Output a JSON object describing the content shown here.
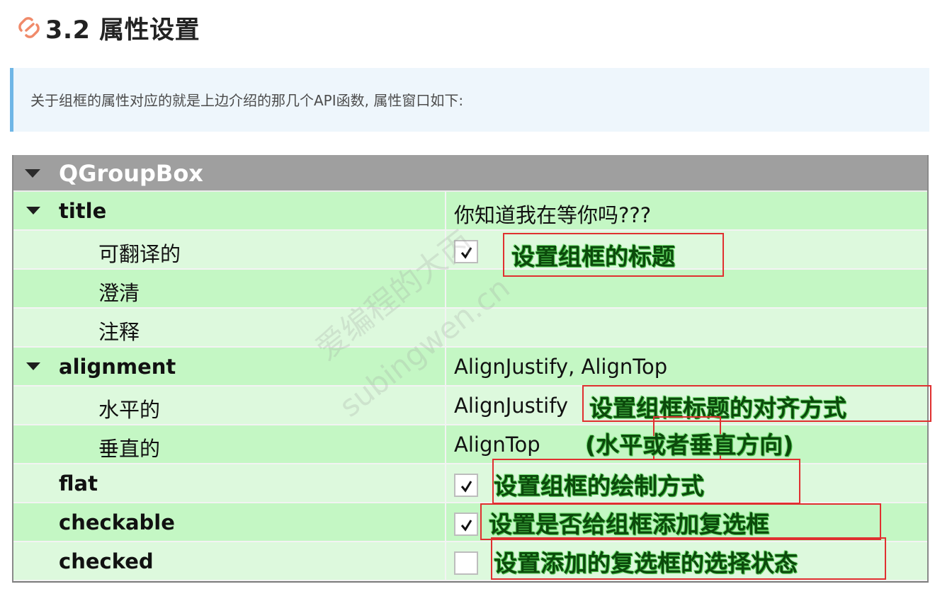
{
  "section": {
    "number_title": "3.2 属性设置",
    "icon": "link-icon",
    "note": "关于组框的属性对应的就是上边介绍的那几个API函数, 属性窗口如下:"
  },
  "property_editor": {
    "class_name": "QGroupBox",
    "rows": [
      {
        "name": "title",
        "value": "你知道我在等你吗???"
      },
      {
        "name": "可翻译的",
        "checked": true
      },
      {
        "name": "澄清",
        "value": ""
      },
      {
        "name": "注释",
        "value": ""
      },
      {
        "name": "alignment",
        "value": "AlignJustify, AlignTop"
      },
      {
        "name": "水平的",
        "value": "AlignJustify"
      },
      {
        "name": "垂直的",
        "value": "AlignTop"
      },
      {
        "name": "flat",
        "checked": true
      },
      {
        "name": "checkable",
        "checked": true
      },
      {
        "name": "checked",
        "checked": false
      }
    ]
  },
  "annotations": {
    "title_label": "设置组框的标题",
    "alignment_label": "设置组框标题的对齐方式",
    "alignment_sub": "(水平或者垂直方向)",
    "flat_label": "设置组框的绘制方式",
    "checkable_label": "设置是否给组框添加复选框",
    "checked_label": "设置添加的复选框的选择状态"
  },
  "watermark": {
    "line1": "爱编程的大丙",
    "line2": "subingwen.cn"
  },
  "colors": {
    "row_dark": "#c4f7c4",
    "row_light": "#ddf9dd",
    "header": "#9f9f9f",
    "annotation_box": "#e03030",
    "note_border": "#6fb6e6"
  }
}
